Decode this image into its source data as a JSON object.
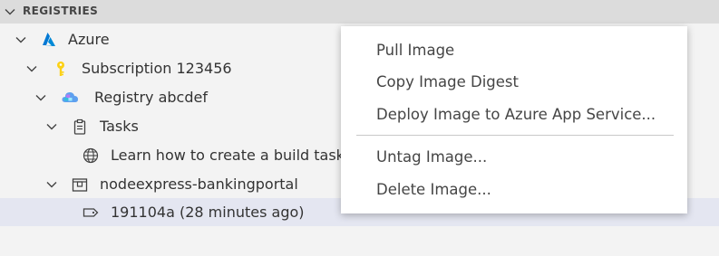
{
  "section": {
    "title": "REGISTRIES"
  },
  "tree": {
    "azure_label": "Azure",
    "subscription_label": "Subscription 123456",
    "registry_label": "Registry abcdef",
    "tasks_label": "Tasks",
    "learn_label": "Learn how to create a build task...",
    "repo_label": "nodeexpress-bankingportal",
    "tag_label": "191104a (28 minutes ago)"
  },
  "context_menu": {
    "pull": "Pull Image",
    "copy_digest": "Copy Image Digest",
    "deploy": "Deploy Image to Azure App Service...",
    "untag": "Untag Image...",
    "delete": "Delete Image..."
  },
  "colors": {
    "selected_row": "#e4e6f1",
    "azure_blue": "#0078d4",
    "key_yellow": "#fcd116"
  }
}
